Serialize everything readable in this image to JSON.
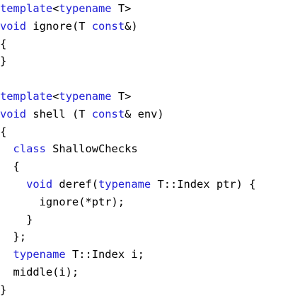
{
  "colors": {
    "keyword": "#1f1fd6",
    "text": "#000000",
    "background": "#ffffff"
  },
  "code_lines": [
    {
      "tokens": [
        {
          "t": "template",
          "kw": true
        },
        {
          "t": "<"
        },
        {
          "t": "typename",
          "kw": true
        },
        {
          "t": " T>"
        }
      ]
    },
    {
      "tokens": [
        {
          "t": "void",
          "kw": true
        },
        {
          "t": " ignore(T "
        },
        {
          "t": "const",
          "kw": true
        },
        {
          "t": "&)"
        }
      ]
    },
    {
      "tokens": [
        {
          "t": "{"
        }
      ]
    },
    {
      "tokens": [
        {
          "t": "}"
        }
      ]
    },
    {
      "tokens": []
    },
    {
      "tokens": [
        {
          "t": "template",
          "kw": true
        },
        {
          "t": "<"
        },
        {
          "t": "typename",
          "kw": true
        },
        {
          "t": " T>"
        }
      ]
    },
    {
      "tokens": [
        {
          "t": "void",
          "kw": true
        },
        {
          "t": " shell (T "
        },
        {
          "t": "const",
          "kw": true
        },
        {
          "t": "& env)"
        }
      ]
    },
    {
      "tokens": [
        {
          "t": "{"
        }
      ]
    },
    {
      "tokens": [
        {
          "t": "  "
        },
        {
          "t": "class",
          "kw": true
        },
        {
          "t": " ShallowChecks"
        }
      ]
    },
    {
      "tokens": [
        {
          "t": "  {"
        }
      ]
    },
    {
      "tokens": [
        {
          "t": "    "
        },
        {
          "t": "void",
          "kw": true
        },
        {
          "t": " deref("
        },
        {
          "t": "typename",
          "kw": true
        },
        {
          "t": " T::Index ptr) {"
        }
      ]
    },
    {
      "tokens": [
        {
          "t": "      ignore(*ptr);"
        }
      ]
    },
    {
      "tokens": [
        {
          "t": "    }"
        }
      ]
    },
    {
      "tokens": [
        {
          "t": "  };"
        }
      ]
    },
    {
      "tokens": [
        {
          "t": "  "
        },
        {
          "t": "typename",
          "kw": true
        },
        {
          "t": " T::Index i;"
        }
      ]
    },
    {
      "tokens": [
        {
          "t": "  middle(i);"
        }
      ]
    },
    {
      "tokens": [
        {
          "t": "}"
        }
      ]
    }
  ]
}
